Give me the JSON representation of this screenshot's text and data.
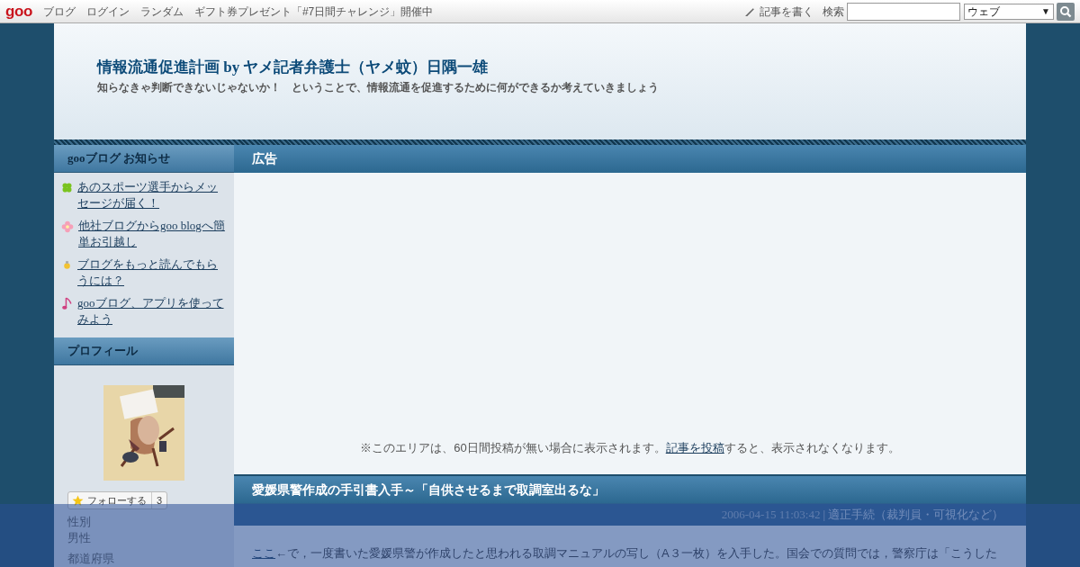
{
  "topbar": {
    "logo": "goo",
    "links": [
      "ブログ",
      "ログイン",
      "ランダム",
      "ギフト券プレゼント「#7日間チャレンジ」開催中"
    ],
    "write": "記事を書く",
    "search_label": "検索",
    "select": "ウェブ",
    "select_caret": "▼"
  },
  "header": {
    "title": "情報流通促進計画 by ヤメ記者弁護士（ヤメ蚊）日隅一雄",
    "subtitle": "知らなきゃ判断できないじゃないか！　ということで、情報流通を促進するために何ができるか考えていきましょう"
  },
  "sidebar": {
    "notice_title": "gooブログ お知らせ",
    "notices": [
      {
        "kind": "clover",
        "text": "あのスポーツ選手からメッセージが届く！"
      },
      {
        "kind": "flower",
        "text": "他社ブログからgoo blogへ簡単お引越し"
      },
      {
        "kind": "bulb",
        "text": "ブログをもっと読んでもらうには？"
      },
      {
        "kind": "note",
        "text": "gooブログ、アプリを使ってみよう"
      }
    ],
    "profile_title": "プロフィール",
    "follow": "フォローする",
    "follow_count": "3",
    "fields": [
      {
        "label": "性別",
        "value": "男性"
      },
      {
        "label": "都道府県"
      }
    ]
  },
  "ad": {
    "title": "広告",
    "note_before": "※このエリアは、60日間投稿が無い場合に表示されます。",
    "note_link": "記事を投稿",
    "note_after": "すると、表示されなくなります。"
  },
  "article": {
    "title": "愛媛県警作成の手引書入手～「自供させるまで取調室出るな」",
    "date": "2006-04-15 11:03:42",
    "separator": "|",
    "category": "適正手続（裁判員・可視化など）",
    "link": "ここ",
    "body": "←で，一度書いた愛媛県警が作成したと思われる取調マニュアルの写し（A３一枚）を入手した。国会での質問では，警察庁は「こうした"
  }
}
